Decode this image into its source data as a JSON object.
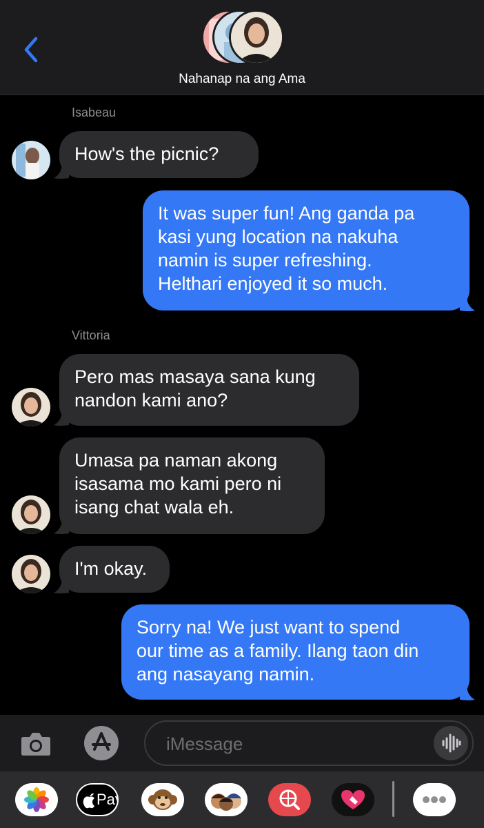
{
  "header": {
    "group_name": "Nahanap na ang Ama"
  },
  "messages": [
    {
      "sender": "Isabeau",
      "text": "How's the picnic?",
      "direction": "received"
    },
    {
      "text": "It was super fun! Ang ganda pa\nkasi yung location na nakuha\nnamin is super refreshing.\nHelthari enjoyed it so much.",
      "direction": "sent"
    },
    {
      "sender": "Vittoria",
      "text": "Pero mas masaya sana kung\nnandon kami ano?",
      "direction": "received"
    },
    {
      "text": "Umasa pa naman akong\nisasama mo kami pero ni\nisang chat wala eh.",
      "direction": "received"
    },
    {
      "text": "I'm okay.",
      "direction": "received"
    },
    {
      "text": "Sorry na! We just want to spend\nour time as a family. Ilang taon din\nang nasayang namin.",
      "direction": "sent"
    }
  ],
  "compose": {
    "placeholder": "iMessage"
  },
  "app_strip": {
    "apple_pay_label": "Pay"
  },
  "colors": {
    "sent_bubble": "#3478f6",
    "received_bubble": "#2c2c2e",
    "background": "#000000"
  }
}
